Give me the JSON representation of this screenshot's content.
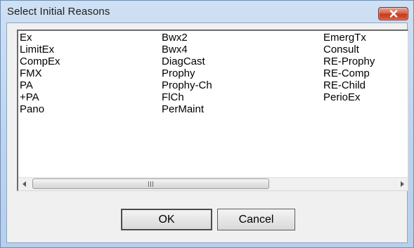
{
  "window": {
    "title": "Select Initial Reasons",
    "close_icon": "close-icon"
  },
  "listbox": {
    "columns": [
      [
        "Ex",
        "LimitEx",
        "CompEx",
        "FMX",
        "PA",
        "+PA",
        "Pano"
      ],
      [
        "Bwx2",
        "Bwx4",
        "DiagCast",
        "Prophy",
        "Prophy-Ch",
        "FlCh",
        "PerMaint"
      ],
      [
        "EmergTx",
        "Consult",
        "RE-Prophy",
        "RE-Comp",
        "RE-Child",
        "PerioEx"
      ]
    ]
  },
  "scrollbar": {
    "left_icon": "scroll-left-arrow-icon",
    "right_icon": "scroll-right-arrow-icon",
    "position": 0.0
  },
  "buttons": {
    "ok_label": "OK",
    "cancel_label": "Cancel"
  },
  "colors": {
    "title_bar": "#bcd3ee",
    "close_button": "#c8452a",
    "dialog_face": "#f0f0f0"
  }
}
